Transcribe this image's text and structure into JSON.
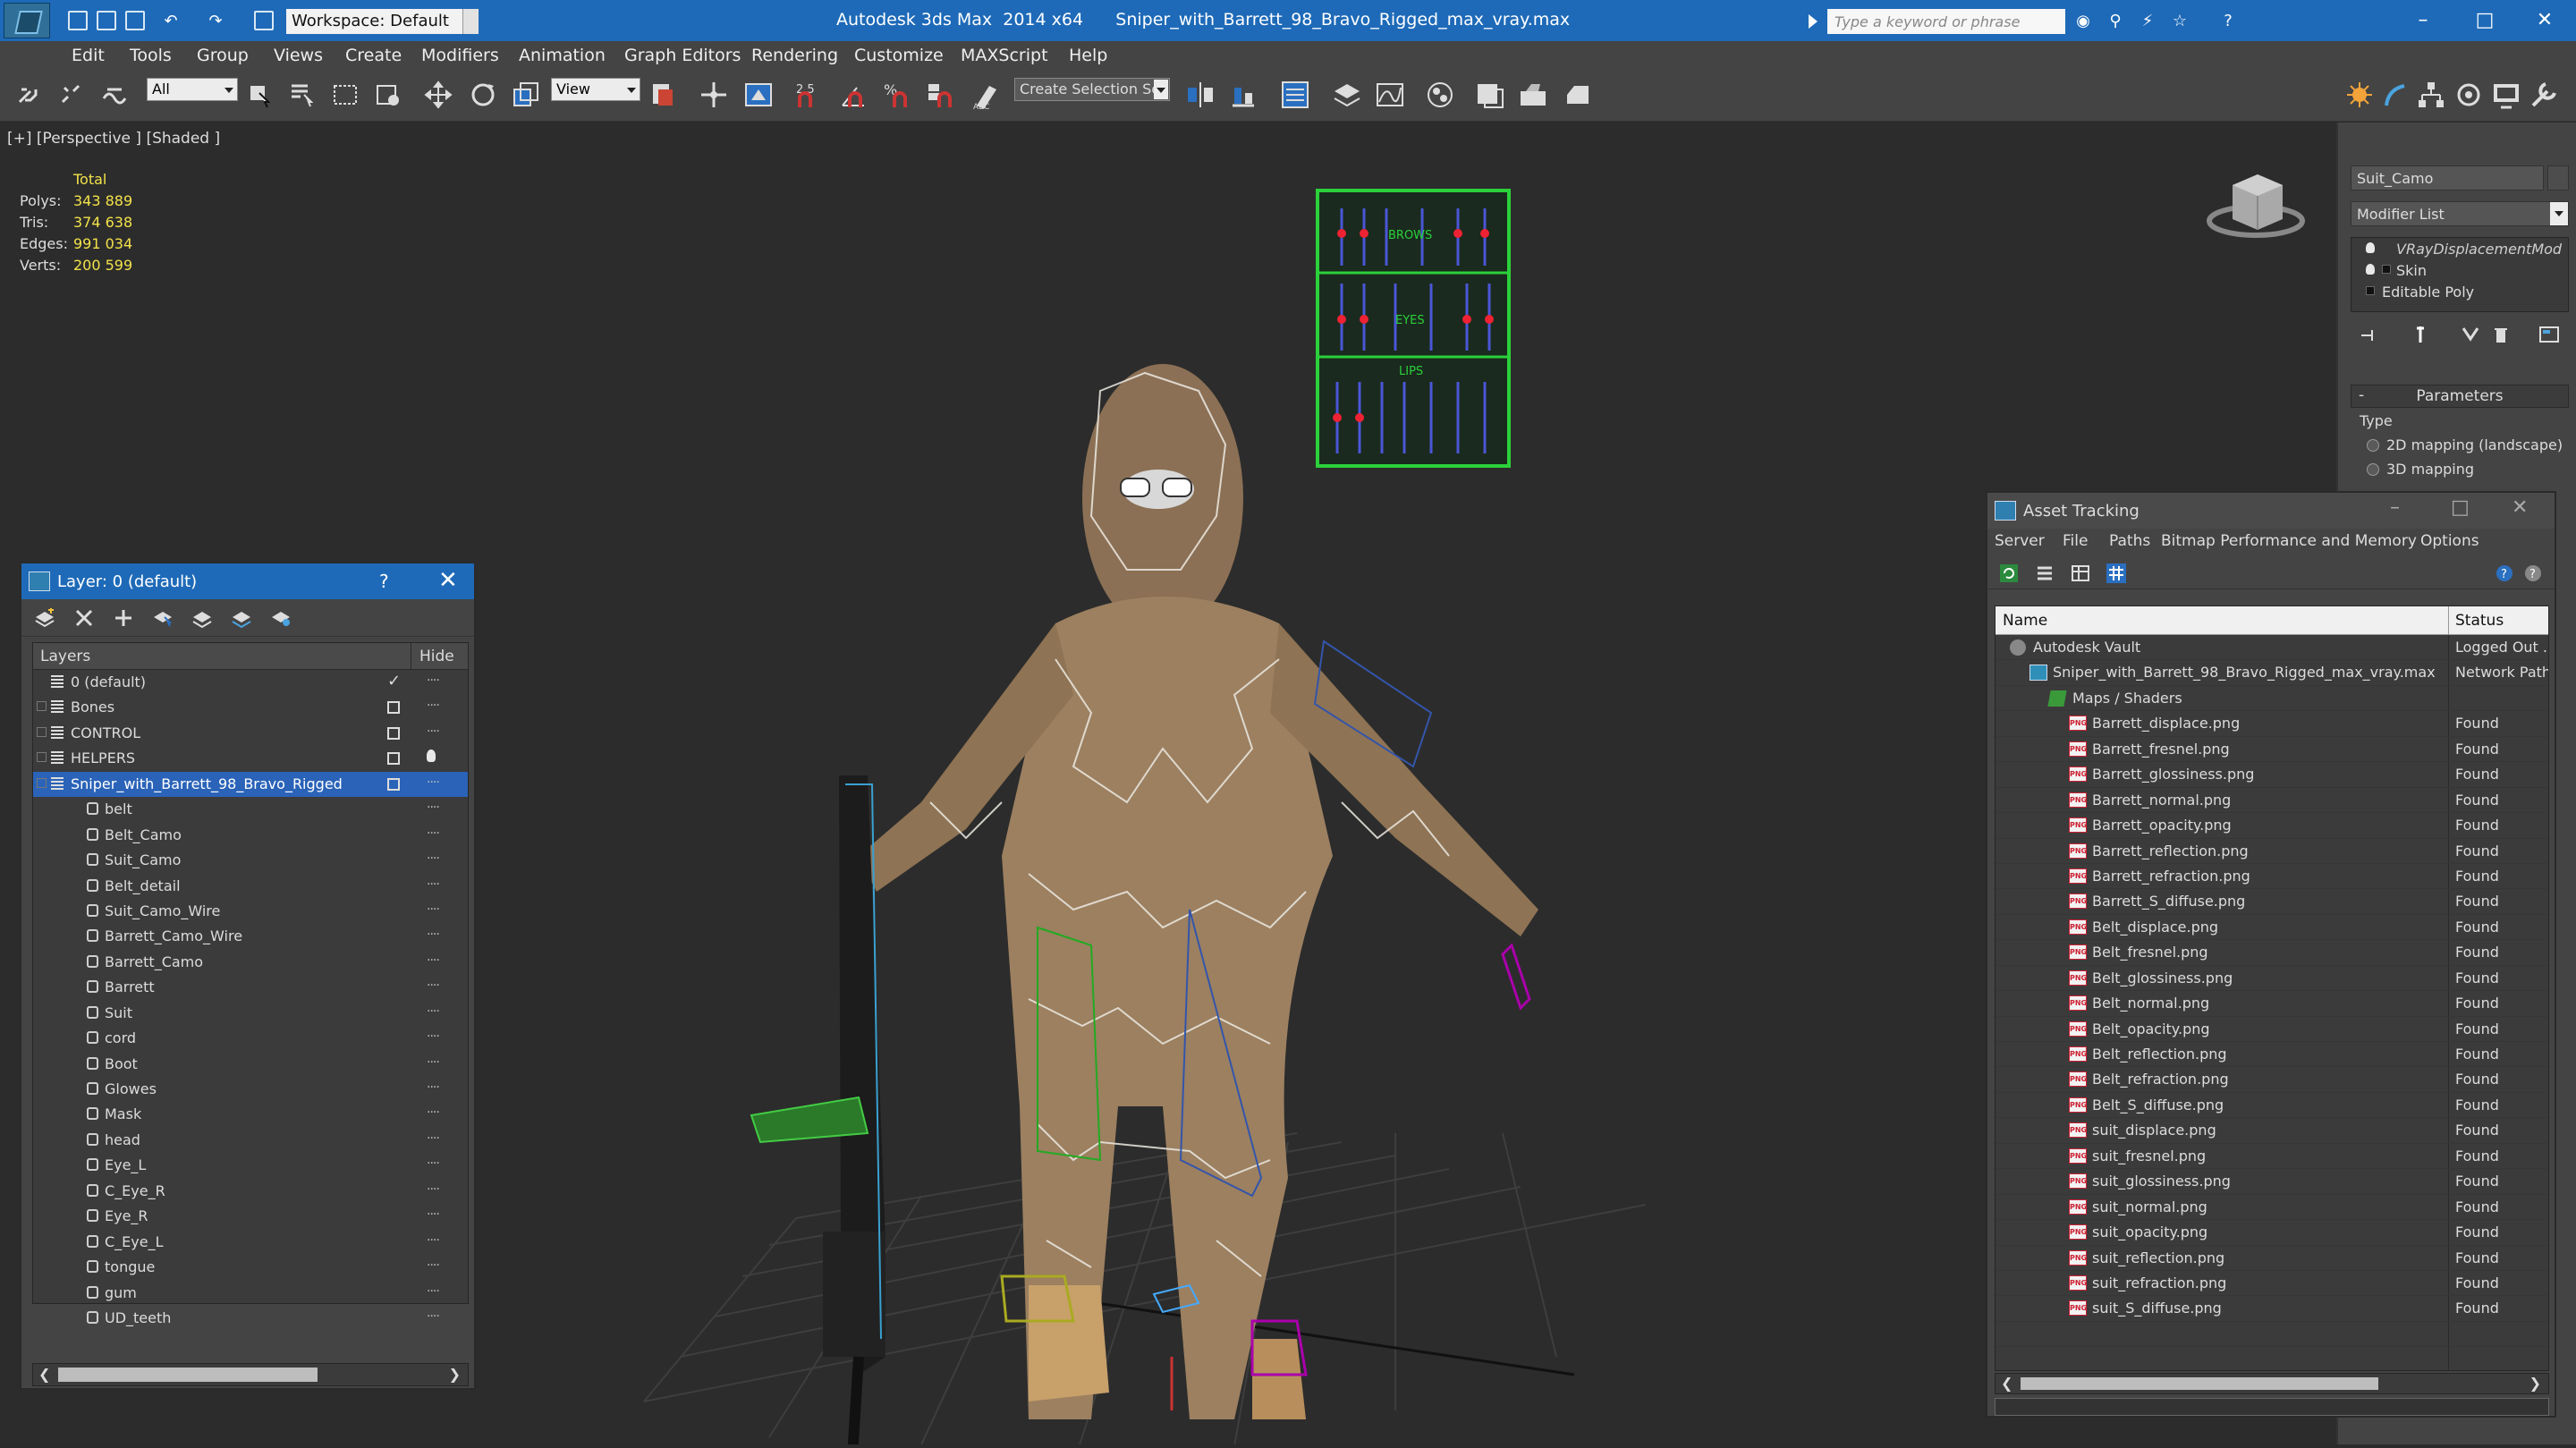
{
  "titlebar": {
    "workspace": "Workspace: Default",
    "title": "Autodesk 3ds Max  2014 x64      Sniper_with_Barrett_98_Bravo_Rigged_max_vray.max",
    "search_placeholder": "Type a keyword or phrase"
  },
  "menu": [
    "Edit",
    "Tools",
    "Group",
    "Views",
    "Create",
    "Modifiers",
    "Animation",
    "Graph Editors",
    "Rendering",
    "Customize",
    "MAXScript",
    "Help"
  ],
  "toolbar": {
    "filter": "All",
    "ref_coord": "View",
    "selection_set": "Create Selection Se",
    "snap_label": "2.5"
  },
  "viewport": {
    "label": "[+] [Perspective ] [Shaded ]",
    "stats_header": "Total",
    "stats": [
      {
        "k": "Polys:",
        "v": "343 889"
      },
      {
        "k": "Tris:",
        "v": "374 638"
      },
      {
        "k": "Edges:",
        "v": "991 034"
      },
      {
        "k": "Verts:",
        "v": "200 599"
      }
    ],
    "board_labels": {
      "brows": "BROWS",
      "eyes": "EYES",
      "lips": "LIPS"
    }
  },
  "command_panel": {
    "object_name": "Suit_Camo",
    "modifier_list": "Modifier List",
    "stack": [
      "VRayDisplacementMod",
      "Skin",
      "Editable Poly"
    ],
    "params_title": "Parameters",
    "type_label": "Type",
    "radio": [
      "2D mapping (landscape)",
      "3D mapping"
    ]
  },
  "layer_dialog": {
    "title": "Layer: 0 (default)",
    "help": "?",
    "col_layers": "Layers",
    "col_hide": "Hide",
    "rows": [
      {
        "name": "0 (default)",
        "kind": "layer",
        "level": 0,
        "hide": "check"
      },
      {
        "name": "Bones",
        "kind": "layer",
        "level": 0,
        "hide": "box",
        "expander": true
      },
      {
        "name": "CONTROL",
        "kind": "layer",
        "level": 0,
        "hide": "box",
        "expander": true
      },
      {
        "name": "HELPERS",
        "kind": "layer",
        "level": 0,
        "hide": "box",
        "expander": true,
        "bulb": true
      },
      {
        "name": "Sniper_with_Barrett_98_Bravo_Rigged",
        "kind": "layer",
        "level": 0,
        "hide": "box",
        "expander": true,
        "selected": true
      },
      {
        "name": "belt",
        "kind": "obj",
        "level": 1
      },
      {
        "name": "Belt_Camo",
        "kind": "obj",
        "level": 1
      },
      {
        "name": "Suit_Camo",
        "kind": "obj",
        "level": 1
      },
      {
        "name": "Belt_detail",
        "kind": "obj",
        "level": 1
      },
      {
        "name": "Suit_Camo_Wire",
        "kind": "obj",
        "level": 1
      },
      {
        "name": "Barrett_Camo_Wire",
        "kind": "obj",
        "level": 1
      },
      {
        "name": "Barrett_Camo",
        "kind": "obj",
        "level": 1
      },
      {
        "name": "Barrett",
        "kind": "obj",
        "level": 1
      },
      {
        "name": "Suit",
        "kind": "obj",
        "level": 1
      },
      {
        "name": "cord",
        "kind": "obj",
        "level": 1
      },
      {
        "name": "Boot",
        "kind": "obj",
        "level": 1
      },
      {
        "name": "Glowes",
        "kind": "obj",
        "level": 1
      },
      {
        "name": "Mask",
        "kind": "obj",
        "level": 1
      },
      {
        "name": "head",
        "kind": "obj",
        "level": 1
      },
      {
        "name": "Eye_L",
        "kind": "obj",
        "level": 1
      },
      {
        "name": "C_Eye_R",
        "kind": "obj",
        "level": 1
      },
      {
        "name": "Eye_R",
        "kind": "obj",
        "level": 1
      },
      {
        "name": "C_Eye_L",
        "kind": "obj",
        "level": 1
      },
      {
        "name": "tongue",
        "kind": "obj",
        "level": 1
      },
      {
        "name": "gum",
        "kind": "obj",
        "level": 1
      },
      {
        "name": "UD_teeth",
        "kind": "obj",
        "level": 1
      }
    ]
  },
  "asset_tracking": {
    "title": "Asset Tracking",
    "menu": [
      "Server",
      "File",
      "Paths",
      "Bitmap Performance and Memory",
      "Options"
    ],
    "col_name": "Name",
    "col_status": "Status",
    "rows": [
      {
        "name": "Autodesk Vault",
        "status": "Logged Out ...",
        "level": 0,
        "icon": "vault"
      },
      {
        "name": "Sniper_with_Barrett_98_Bravo_Rigged_max_vray.max",
        "status": "Network Path",
        "level": 1,
        "icon": "max"
      },
      {
        "name": "Maps / Shaders",
        "status": "",
        "level": 2,
        "icon": "maps"
      },
      {
        "name": "Barrett_displace.png",
        "status": "Found",
        "level": 3,
        "icon": "png"
      },
      {
        "name": "Barrett_fresnel.png",
        "status": "Found",
        "level": 3,
        "icon": "png"
      },
      {
        "name": "Barrett_glossiness.png",
        "status": "Found",
        "level": 3,
        "icon": "png"
      },
      {
        "name": "Barrett_normal.png",
        "status": "Found",
        "level": 3,
        "icon": "png"
      },
      {
        "name": "Barrett_opacity.png",
        "status": "Found",
        "level": 3,
        "icon": "png"
      },
      {
        "name": "Barrett_reflection.png",
        "status": "Found",
        "level": 3,
        "icon": "png"
      },
      {
        "name": "Barrett_refraction.png",
        "status": "Found",
        "level": 3,
        "icon": "png"
      },
      {
        "name": "Barrett_S_diffuse.png",
        "status": "Found",
        "level": 3,
        "icon": "png"
      },
      {
        "name": "Belt_displace.png",
        "status": "Found",
        "level": 3,
        "icon": "png"
      },
      {
        "name": "Belt_fresnel.png",
        "status": "Found",
        "level": 3,
        "icon": "png"
      },
      {
        "name": "Belt_glossiness.png",
        "status": "Found",
        "level": 3,
        "icon": "png"
      },
      {
        "name": "Belt_normal.png",
        "status": "Found",
        "level": 3,
        "icon": "png"
      },
      {
        "name": "Belt_opacity.png",
        "status": "Found",
        "level": 3,
        "icon": "png"
      },
      {
        "name": "Belt_reflection.png",
        "status": "Found",
        "level": 3,
        "icon": "png"
      },
      {
        "name": "Belt_refraction.png",
        "status": "Found",
        "level": 3,
        "icon": "png"
      },
      {
        "name": "Belt_S_diffuse.png",
        "status": "Found",
        "level": 3,
        "icon": "png"
      },
      {
        "name": "suit_displace.png",
        "status": "Found",
        "level": 3,
        "icon": "png"
      },
      {
        "name": "suit_fresnel.png",
        "status": "Found",
        "level": 3,
        "icon": "png"
      },
      {
        "name": "suit_glossiness.png",
        "status": "Found",
        "level": 3,
        "icon": "png"
      },
      {
        "name": "suit_normal.png",
        "status": "Found",
        "level": 3,
        "icon": "png"
      },
      {
        "name": "suit_opacity.png",
        "status": "Found",
        "level": 3,
        "icon": "png"
      },
      {
        "name": "suit_reflection.png",
        "status": "Found",
        "level": 3,
        "icon": "png"
      },
      {
        "name": "suit_refraction.png",
        "status": "Found",
        "level": 3,
        "icon": "png"
      },
      {
        "name": "suit_S_diffuse.png",
        "status": "Found",
        "level": 3,
        "icon": "png"
      }
    ]
  },
  "colors": {
    "titlebar": "#1e6ab8",
    "panel": "#444444",
    "viewport": "#2c2c2c",
    "stats": "#f2e24a",
    "selection": "#2a63b8",
    "facial_board": "#2bd13a"
  }
}
